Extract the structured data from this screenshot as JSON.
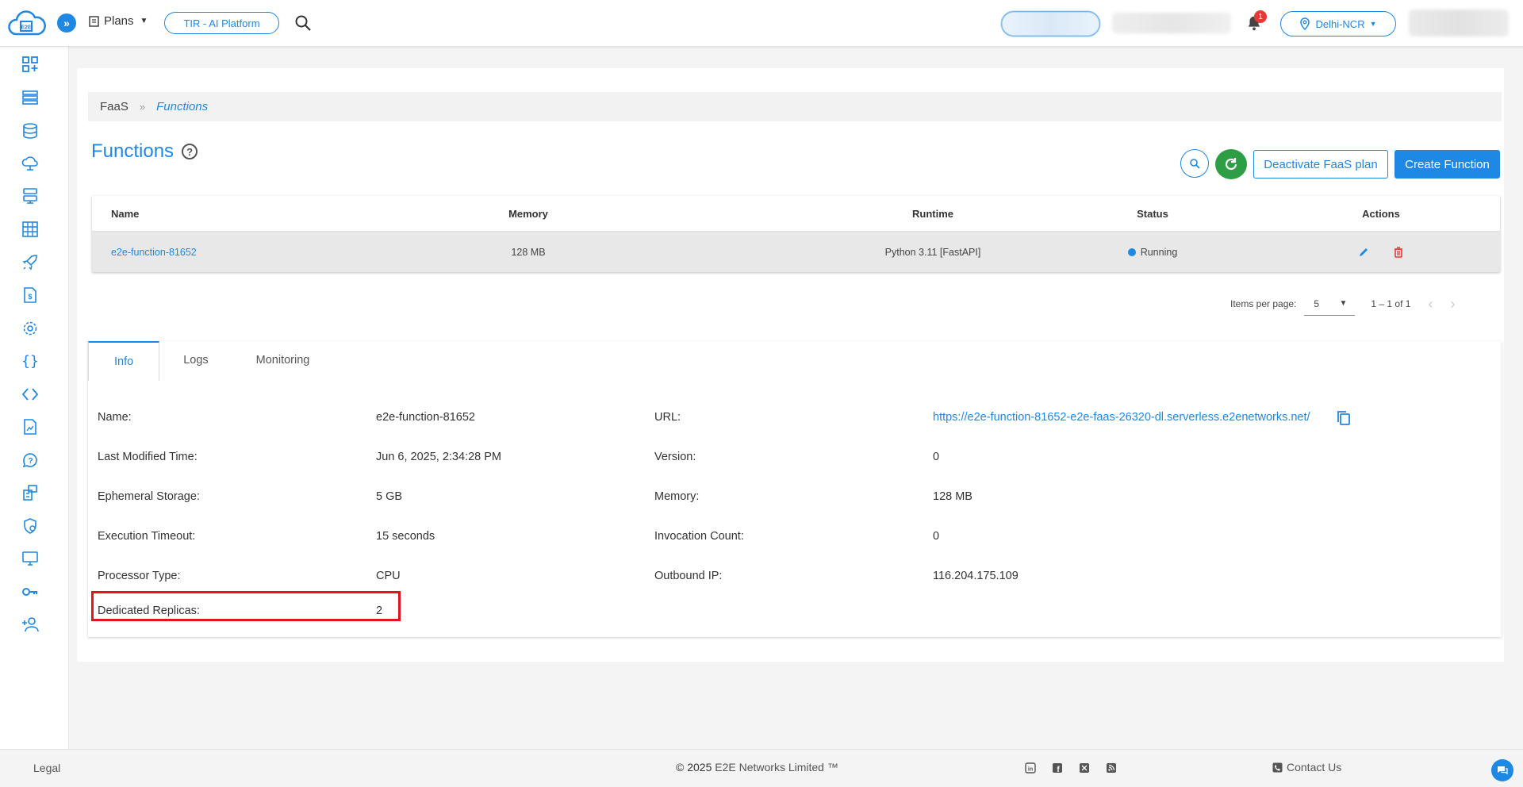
{
  "topbar": {
    "plans_label": "Plans",
    "tir_label": "TIR - AI Platform",
    "notification_count": "1",
    "region_label": "Delhi-NCR"
  },
  "breadcrumb": {
    "root": "FaaS",
    "separator": "»",
    "current": "Functions"
  },
  "page": {
    "title": "Functions",
    "help": "?"
  },
  "toolbar": {
    "deactivate_label": "Deactivate FaaS plan",
    "create_label": "Create Function"
  },
  "table": {
    "headers": {
      "name": "Name",
      "memory": "Memory",
      "runtime": "Runtime",
      "status": "Status",
      "actions": "Actions"
    },
    "rows": [
      {
        "name": "e2e-function-81652",
        "memory": "128 MB",
        "runtime": "Python 3.11 [FastAPI]",
        "status": "Running"
      }
    ]
  },
  "pagination": {
    "items_per_page_label": "Items per page:",
    "items_per_page": "5",
    "range": "1 – 1 of 1"
  },
  "tabs": {
    "info": "Info",
    "logs": "Logs",
    "monitoring": "Monitoring"
  },
  "info": {
    "name_label": "Name:",
    "name_value": "e2e-function-81652",
    "modified_label": "Last Modified Time:",
    "modified_value": "Jun 6, 2025, 2:34:28 PM",
    "storage_label": "Ephemeral Storage:",
    "storage_value": "5 GB",
    "timeout_label": "Execution Timeout:",
    "timeout_value": "15 seconds",
    "processor_label": "Processor Type:",
    "processor_value": "CPU",
    "replicas_label": "Dedicated Replicas:",
    "replicas_value": "2",
    "url_label": "URL:",
    "url_value": "https://e2e-function-81652-e2e-faas-26320-dl.serverless.e2enetworks.net/",
    "version_label": "Version:",
    "version_value": "0",
    "memory_label": "Memory:",
    "memory_value": "128 MB",
    "invocation_label": "Invocation Count:",
    "invocation_value": "0",
    "outbound_label": "Outbound IP:",
    "outbound_value": "116.204.175.109"
  },
  "footer": {
    "legal": "Legal",
    "copyright_prefix": "© 2025",
    "copyright_company": "E2E Networks Limited ™",
    "contact": "Contact Us"
  },
  "colors": {
    "accent": "#1e88e5",
    "success": "#2e9e44",
    "danger": "#e3151a"
  },
  "icons": {
    "sidebar": [
      "dashboard-icon",
      "nodes-icon",
      "database-icon",
      "cloud-icon",
      "servers-icon",
      "grid-icon",
      "rocket-icon",
      "billing-icon",
      "settings-icon",
      "braces-icon",
      "code-icon",
      "document-icon",
      "support-icon",
      "building-icon",
      "security-icon",
      "monitor-icon",
      "key-icon",
      "add-user-icon"
    ]
  }
}
